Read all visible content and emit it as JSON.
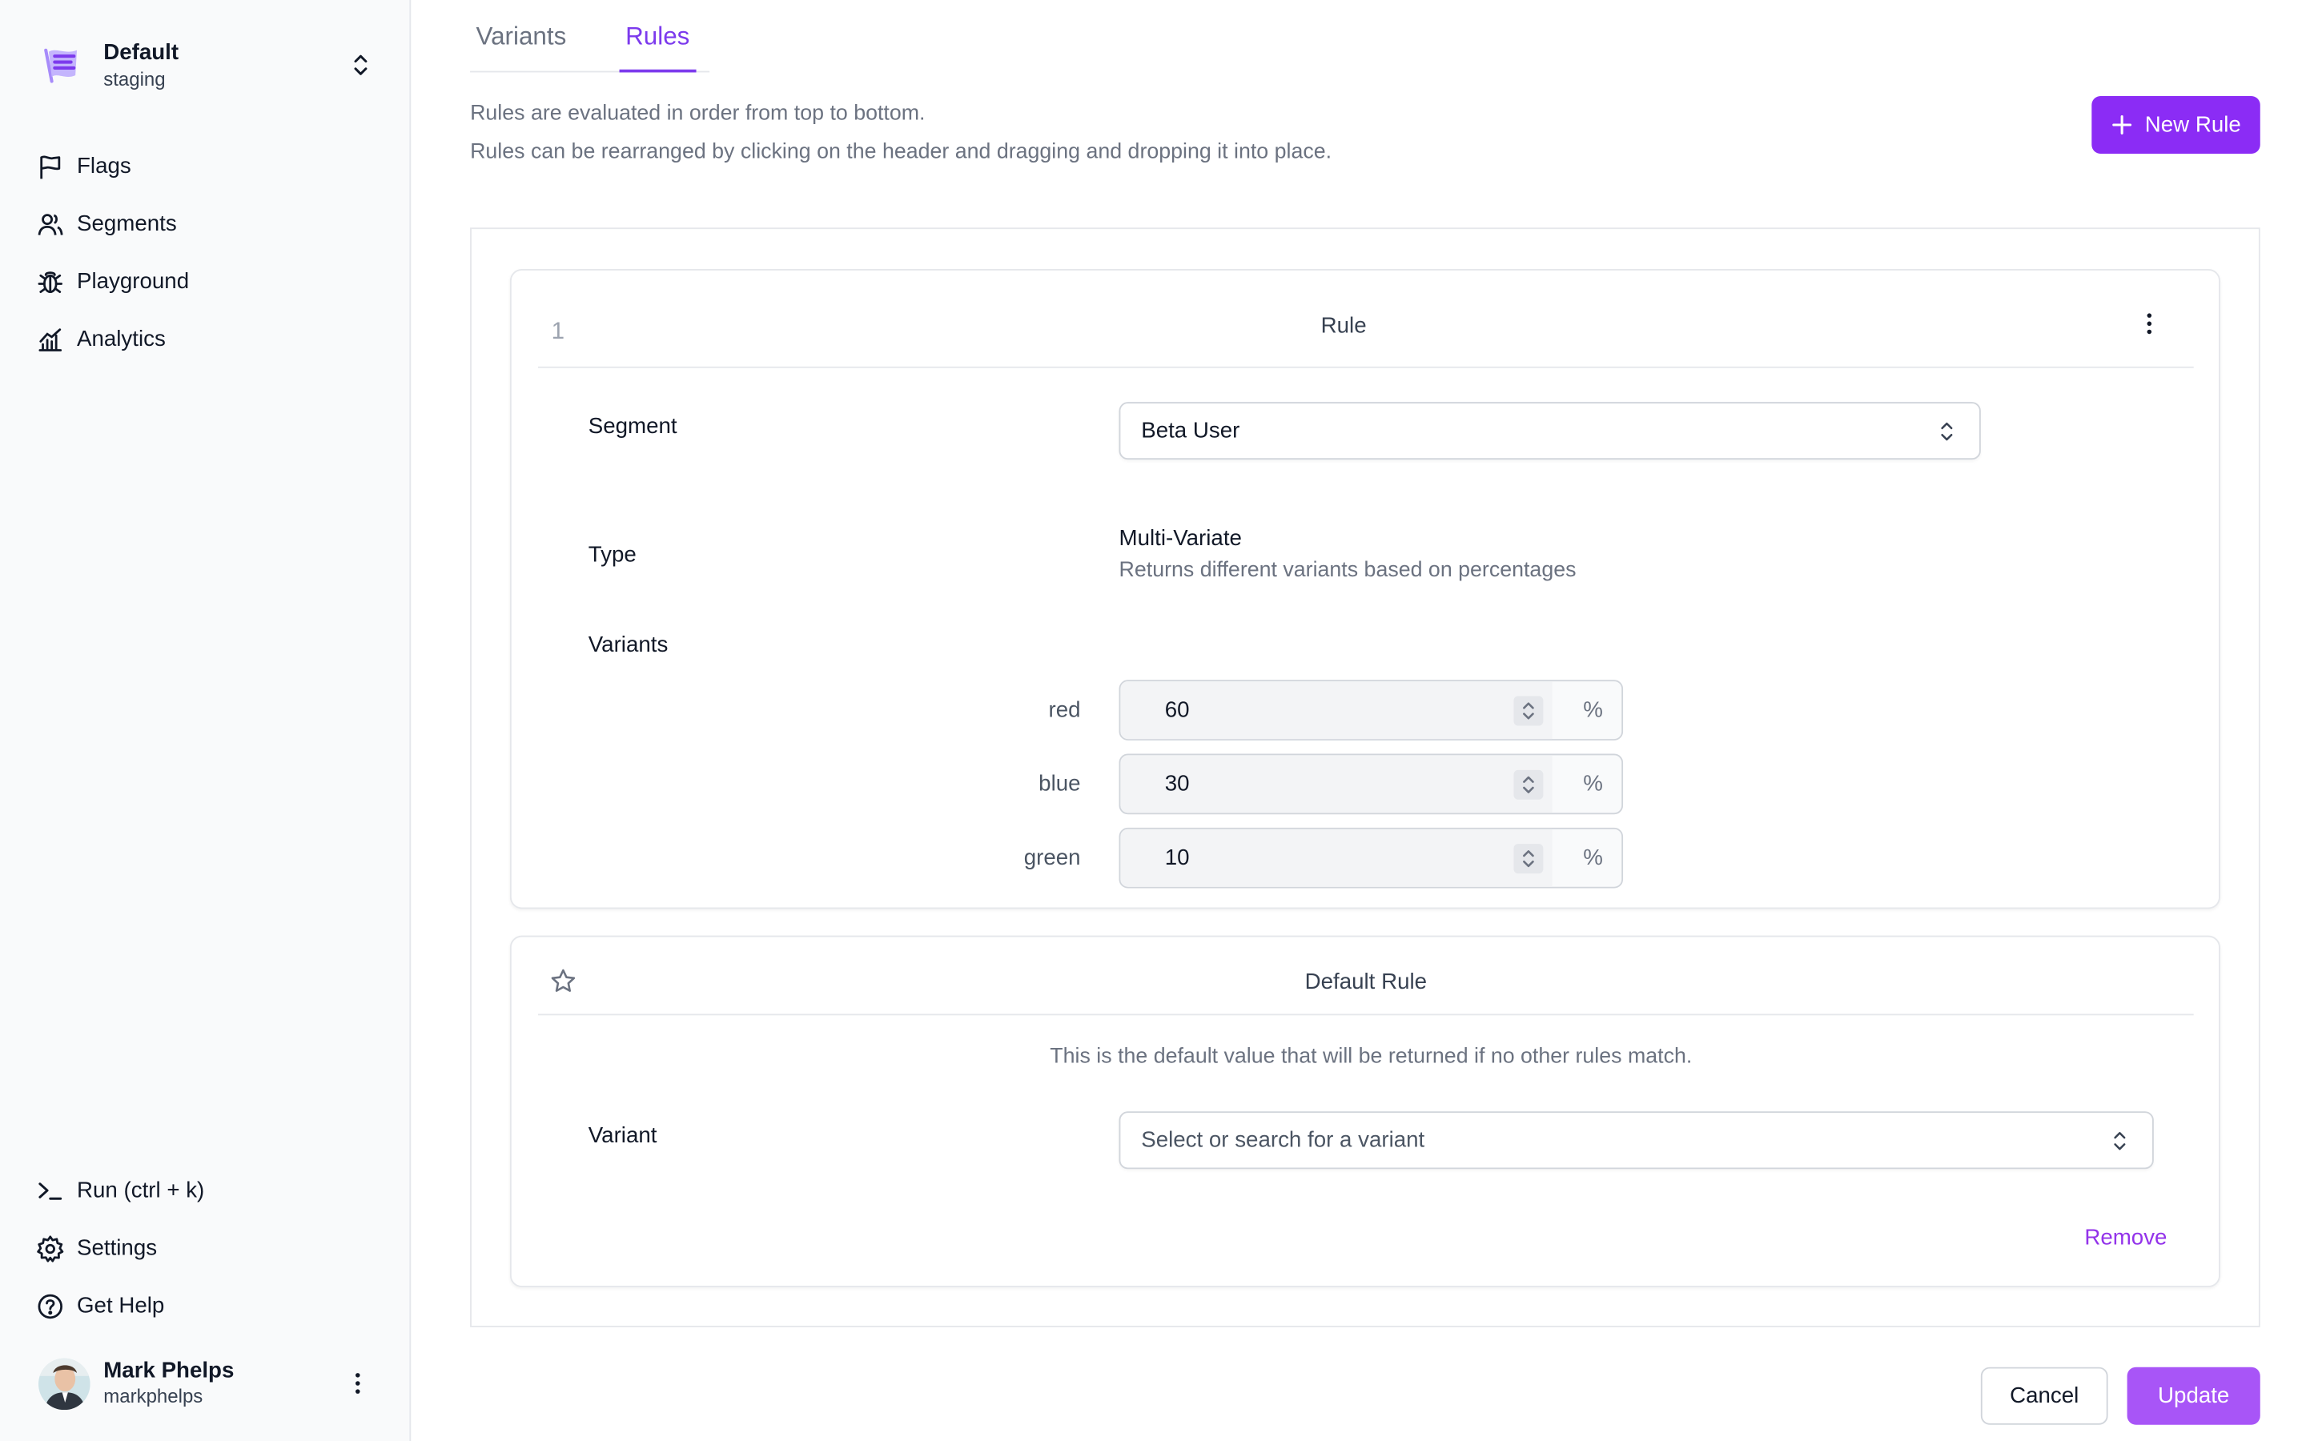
{
  "namespace": {
    "title": "Default",
    "subtitle": "staging"
  },
  "nav": {
    "top": [
      {
        "label": "Flags",
        "icon": "flag-icon"
      },
      {
        "label": "Segments",
        "icon": "users-icon"
      },
      {
        "label": "Playground",
        "icon": "bug-icon"
      },
      {
        "label": "Analytics",
        "icon": "chart-icon"
      }
    ],
    "bottom": [
      {
        "label": "Run (ctrl + k)",
        "icon": "terminal-icon"
      },
      {
        "label": "Settings",
        "icon": "gear-icon"
      },
      {
        "label": "Get Help",
        "icon": "help-icon"
      }
    ]
  },
  "user": {
    "name": "Mark Phelps",
    "handle": "markphelps"
  },
  "tabs": [
    {
      "label": "Variants",
      "active": false
    },
    {
      "label": "Rules",
      "active": true
    }
  ],
  "intro": {
    "line1": "Rules are evaluated in order from top to bottom.",
    "line2": "Rules can be rearranged by clicking on the header and dragging and dropping it into place."
  },
  "new_rule_label": "New Rule",
  "rule": {
    "number": "1",
    "title": "Rule",
    "segment_label": "Segment",
    "segment_value": "Beta User",
    "type_label": "Type",
    "type_title": "Multi-Variate",
    "type_desc": "Returns different variants based on percentages",
    "variants_label": "Variants",
    "variants": [
      {
        "name": "red",
        "value": "60",
        "unit": "%"
      },
      {
        "name": "blue",
        "value": "30",
        "unit": "%"
      },
      {
        "name": "green",
        "value": "10",
        "unit": "%"
      }
    ]
  },
  "default_rule": {
    "title": "Default Rule",
    "desc": "This is the default value that will be returned if no other rules match.",
    "variant_label": "Variant",
    "variant_placeholder": "Select or search for a variant",
    "remove_label": "Remove"
  },
  "actions": {
    "cancel": "Cancel",
    "update": "Update"
  },
  "colors": {
    "accent": "#8b2cf5",
    "accent_light": "#a855f7",
    "link": "#9333ea"
  }
}
